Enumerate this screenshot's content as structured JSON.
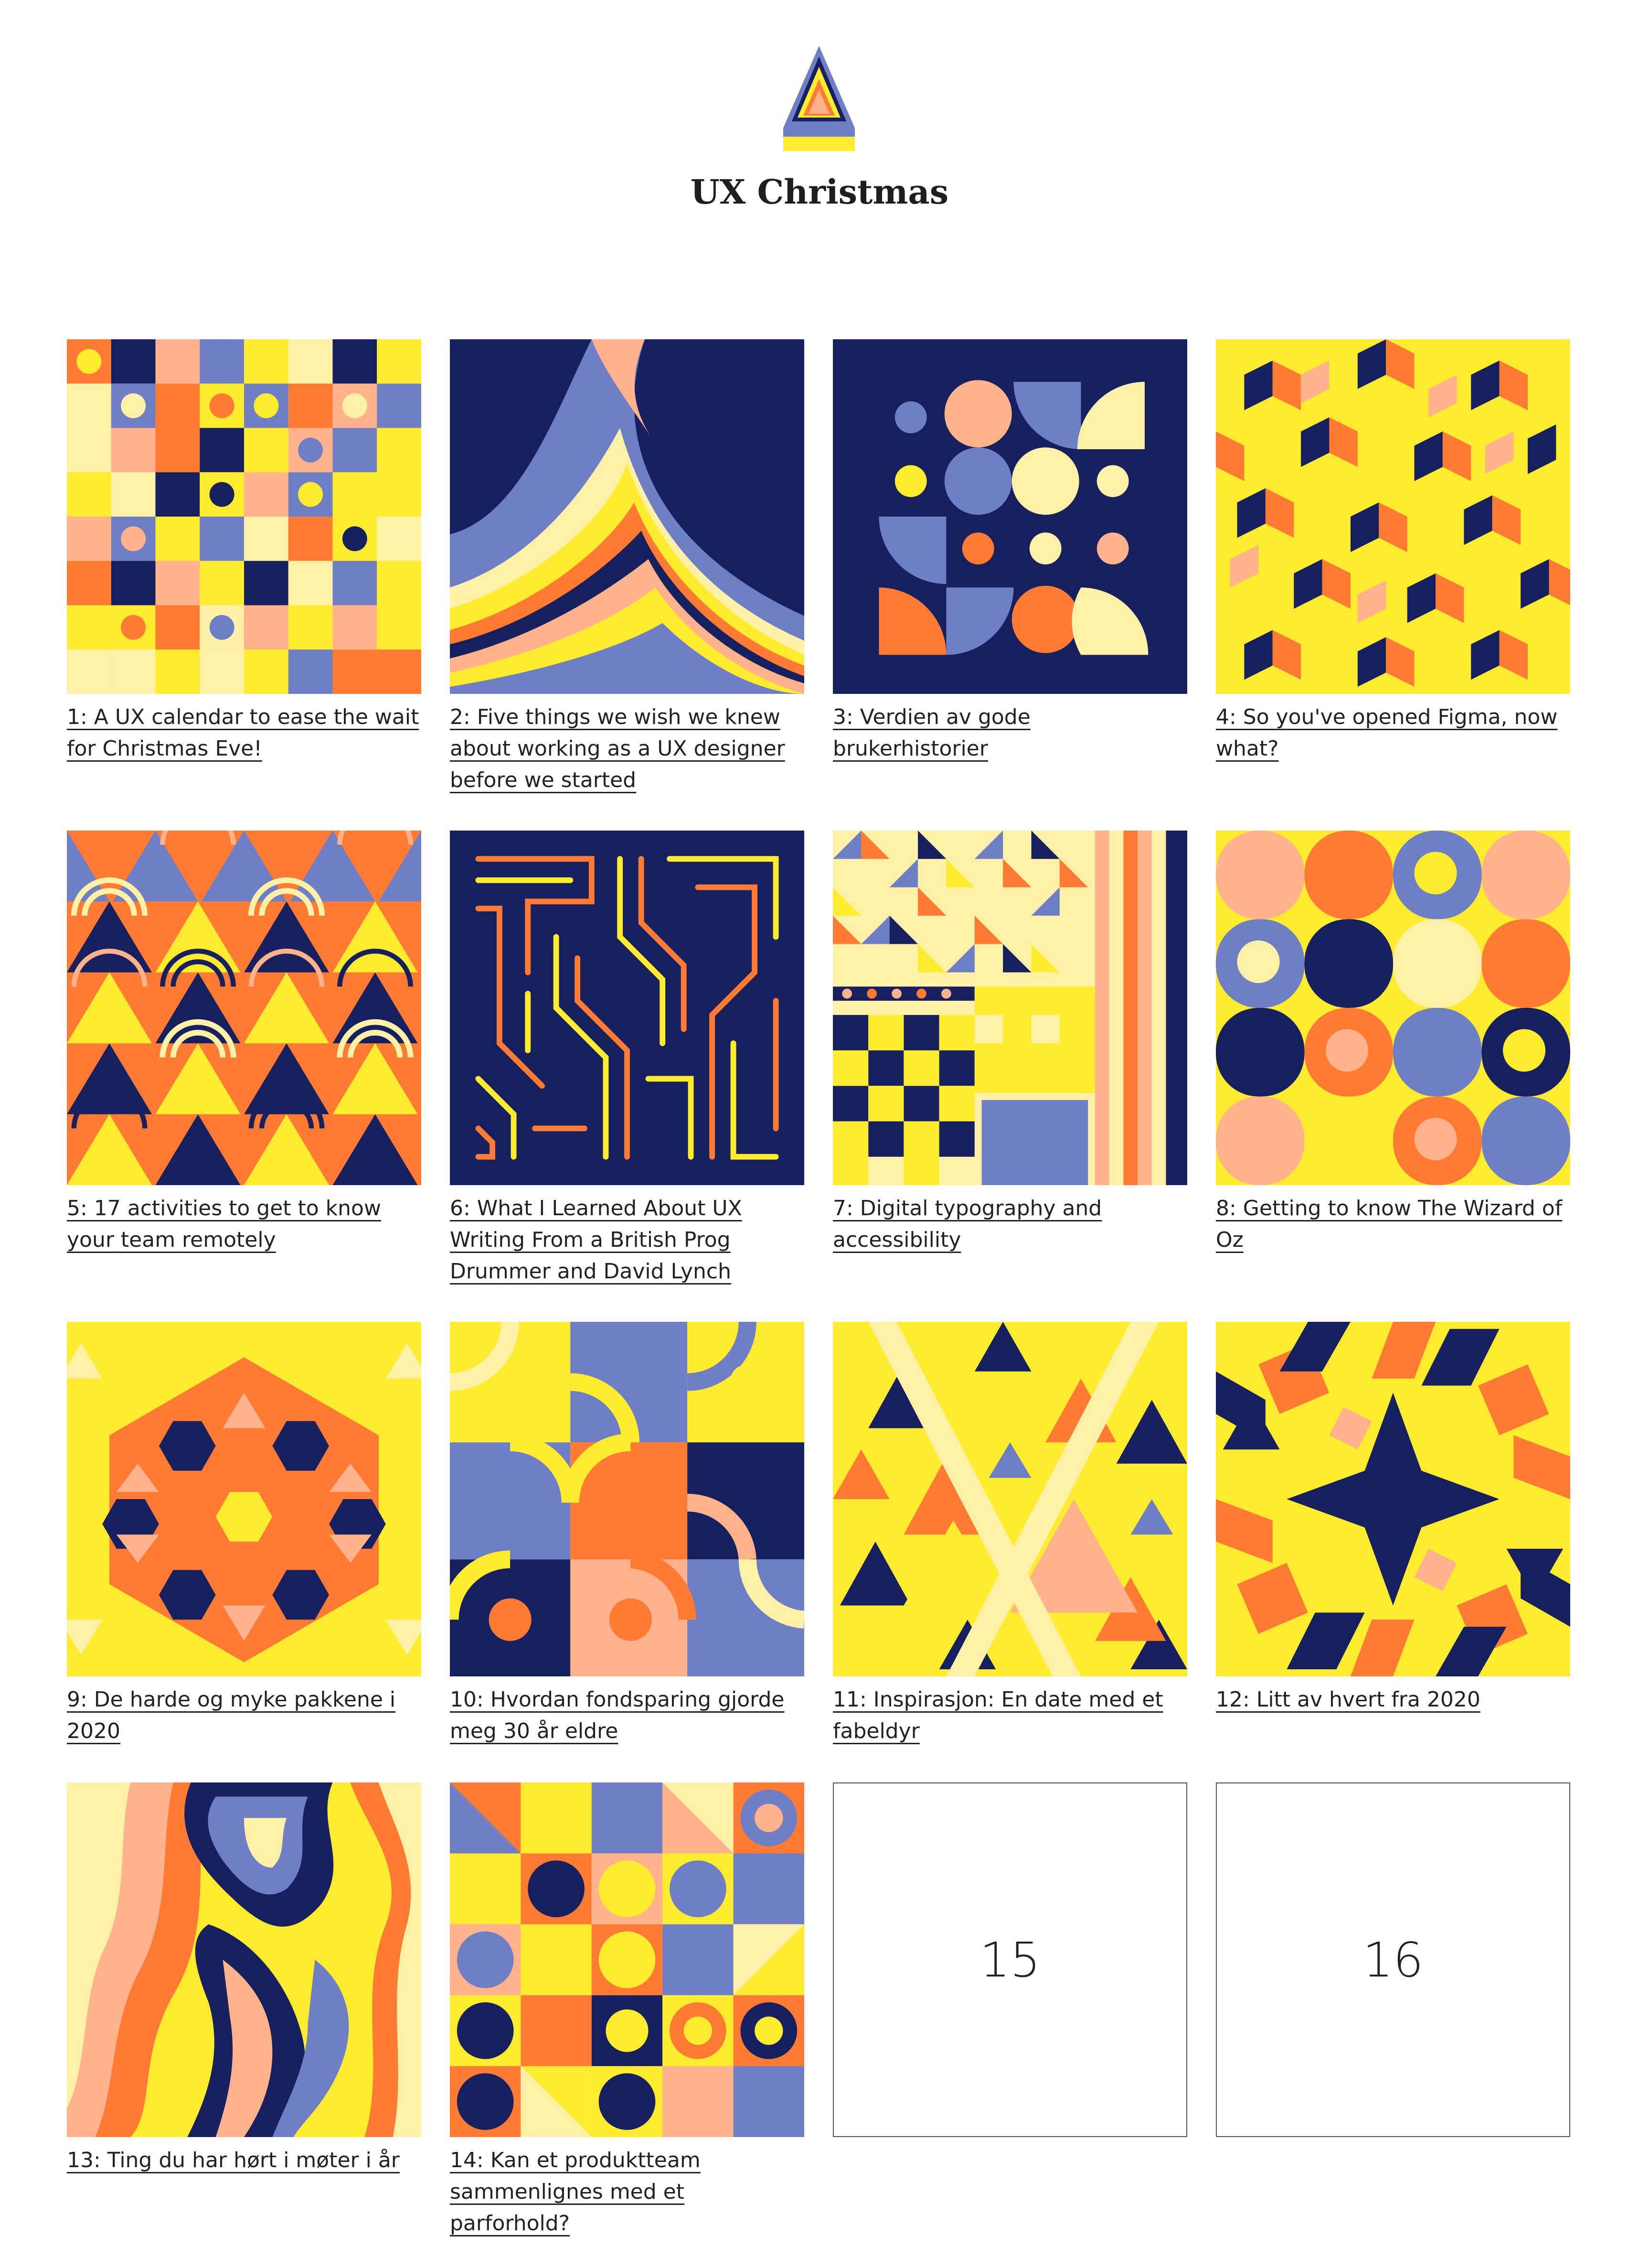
{
  "header": {
    "logo_icon": "stacked-triangles-logo-icon",
    "title": "UX Christmas"
  },
  "palette": {
    "navy": "#17205e",
    "periwinkle": "#6f7fc5",
    "orange": "#ff7a33",
    "peach": "#ffb28c",
    "yellow": "#ffec2e",
    "cream": "#fff1a8"
  },
  "entries": [
    {
      "label": "1: A UX calendar to ease the wait for Christmas Eve!",
      "art": "square-tiles-with-dots"
    },
    {
      "label": "2: Five things we wish we knew about working as a UX designer before we started",
      "art": "flowing-wavy-stripes"
    },
    {
      "label": "3: Verdien av gode brukerhistorier",
      "art": "circles-and-quarter-circles-on-navy"
    },
    {
      "label": "4: So you've opened Figma, now what?",
      "art": "isometric-cubes"
    },
    {
      "label": "5: 17 activities to get to know your team remotely",
      "art": "triangles-and-arcs"
    },
    {
      "label": "6: What I Learned About UX Writing From a British Prog Drummer and David Lynch",
      "art": "maze-lines-on-navy"
    },
    {
      "label": "7: Digital typography and accessibility",
      "art": "triangle-grid-and-checkerboard"
    },
    {
      "label": "8: Getting to know The Wizard of Oz",
      "art": "rounded-blob-tiles"
    },
    {
      "label": "9: De harde og myke pakkene i 2020",
      "art": "hexagon-triangle-star-pattern"
    },
    {
      "label": "10: Hvordan fondsparing gjorde meg 30 år eldre",
      "art": "truchet-arc-tiles"
    },
    {
      "label": "11: Inspirasjon: En date med et fabeldyr",
      "art": "sierpinski-triangles"
    },
    {
      "label": "12: Litt av hvert fra 2020",
      "art": "star-chevron-pattern"
    },
    {
      "label": "13: Ting du har hørt i møter i år",
      "art": "marbled-contour-pattern"
    },
    {
      "label": "14: Kan et produktteam sammenlignes med et parforhold?",
      "art": "geometric-bauhaus-shapes"
    },
    {
      "label": "15",
      "art": "unopened-door"
    },
    {
      "label": "16",
      "art": "unopened-door"
    }
  ]
}
